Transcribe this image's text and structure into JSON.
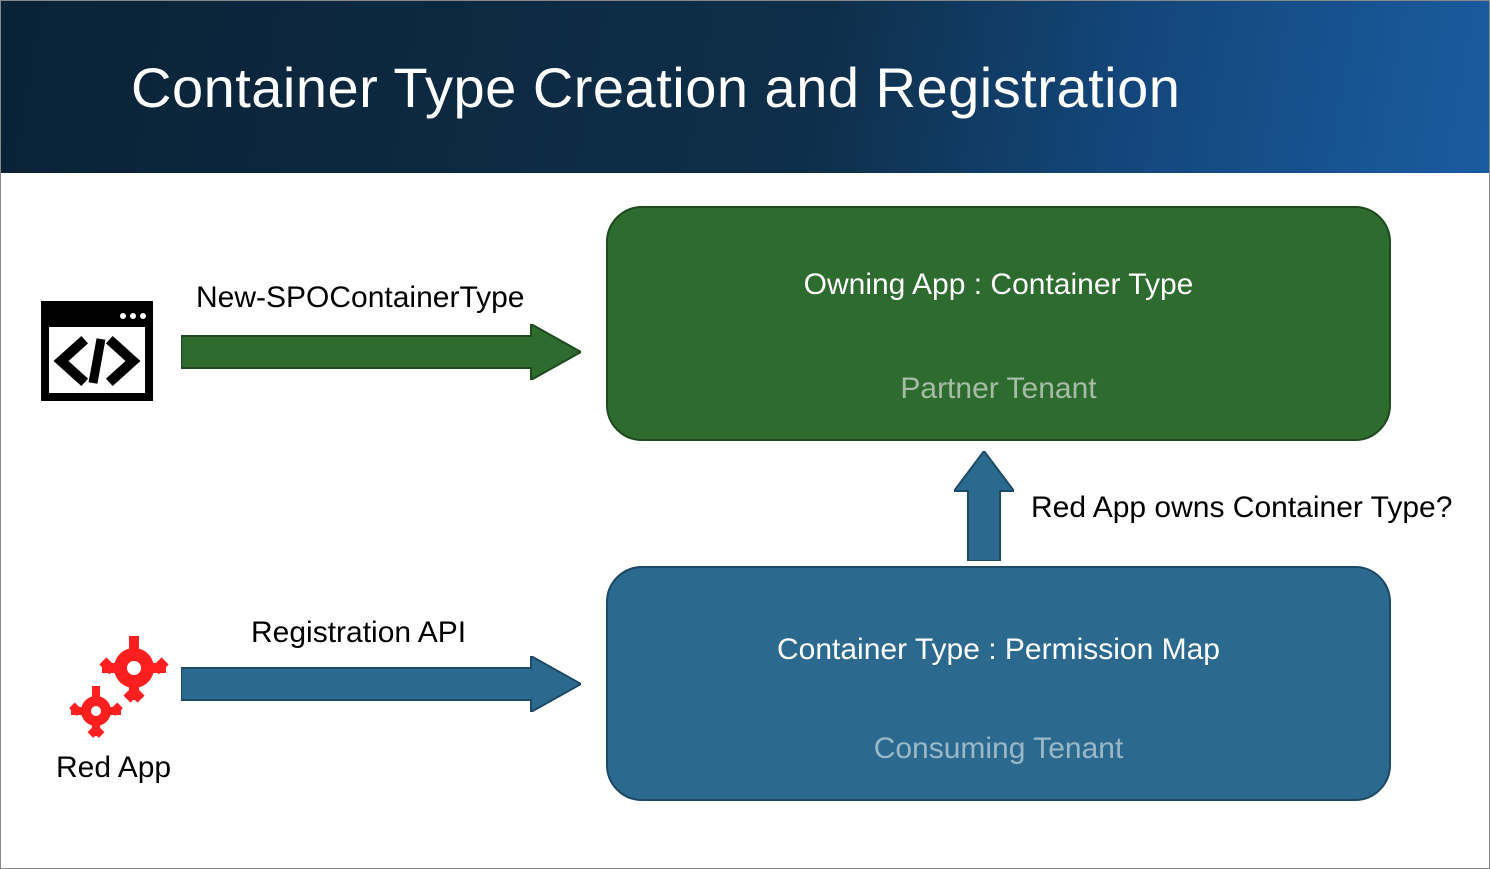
{
  "header": {
    "title": "Container Type Creation and Registration"
  },
  "codeIcon": {
    "name": "code-window-icon"
  },
  "arrowGreen": {
    "label": "New-SPOContainerType",
    "color": "#2e6b2e"
  },
  "partnerBox": {
    "title": "Owning App : Container Type",
    "subtitle": "Partner Tenant",
    "bg": "#2e6b2e"
  },
  "arrowUp": {
    "label": "Red App owns Container Type?",
    "color": "#2b6a8e"
  },
  "arrowBlue": {
    "label": "Registration API",
    "color": "#2b6a8e"
  },
  "redApp": {
    "label": "Red App",
    "color": "#ff1a1a"
  },
  "consumingBox": {
    "title": "Container Type : Permission Map",
    "subtitle": "Consuming Tenant",
    "bg": "#2b6a8e"
  }
}
